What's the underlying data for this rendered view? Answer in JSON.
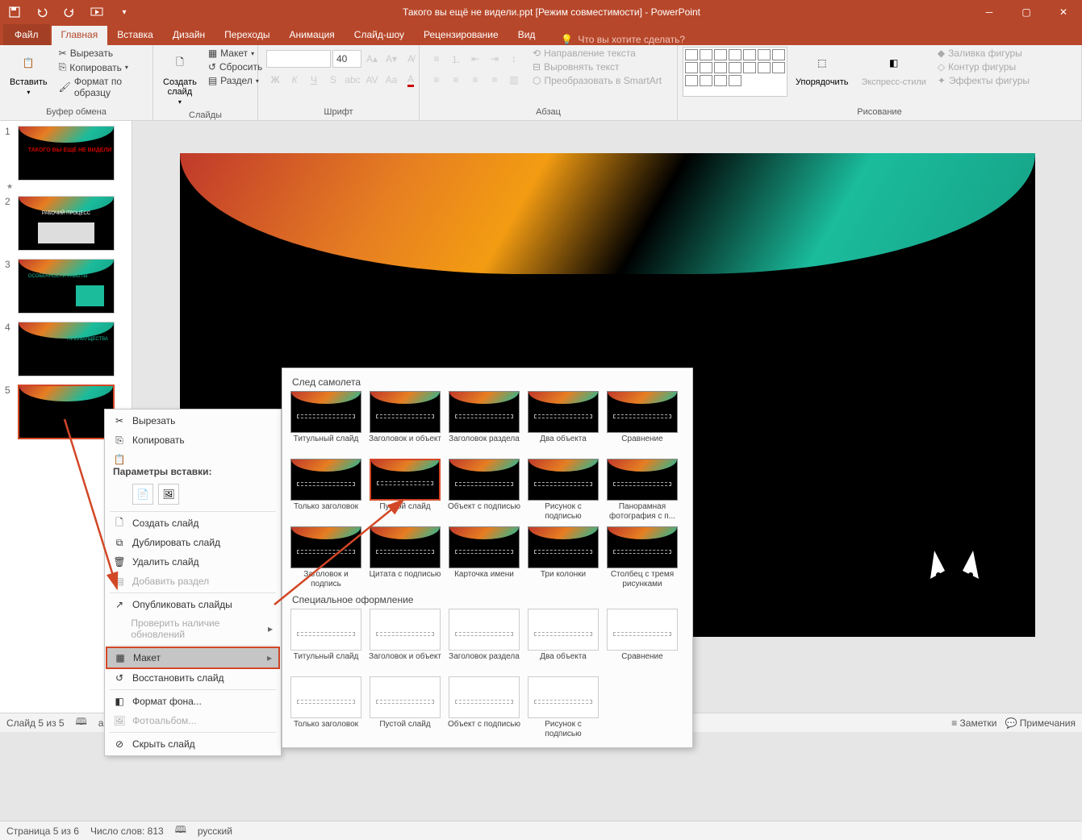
{
  "titlebar": {
    "title": "Такого вы ещё не видели.ppt [Режим совместимости] - PowerPoint"
  },
  "tabs": {
    "file": "Файл",
    "items": [
      "Главная",
      "Вставка",
      "Дизайн",
      "Переходы",
      "Анимация",
      "Слайд-шоу",
      "Рецензирование",
      "Вид"
    ],
    "active_index": 0,
    "tellme": "Что вы хотите сделать?"
  },
  "ribbon": {
    "clipboard": {
      "paste": "Вставить",
      "cut": "Вырезать",
      "copy": "Копировать",
      "format_painter": "Формат по образцу",
      "label": "Буфер обмена"
    },
    "slides": {
      "new_slide": "Создать слайд",
      "layout": "Макет",
      "reset": "Сбросить",
      "section": "Раздел",
      "label": "Слайды"
    },
    "font": {
      "size_value": "40",
      "label": "Шрифт"
    },
    "paragraph": {
      "text_direction": "Направление текста",
      "align_text": "Выровнять текст",
      "smartart": "Преобразовать в SmartArt",
      "label": "Абзац"
    },
    "drawing": {
      "arrange": "Упорядочить",
      "quick_styles": "Экспресс-стили",
      "shape_fill": "Заливка фигуры",
      "shape_outline": "Контур фигуры",
      "shape_effects": "Эффекты фигуры",
      "label": "Рисование"
    }
  },
  "slides": [
    {
      "num": "1",
      "title": "ТАКОГО ВЫ ЕЩЁ НЕ ВИДЕЛИ"
    },
    {
      "num": "2",
      "title": "РАБОЧИЙ ПРОЦЕСС"
    },
    {
      "num": "3",
      "title": "ОСОБЕННОСТИ РАБОТЫ"
    },
    {
      "num": "4",
      "title": "ПРЕИМУЩЕСТВА"
    },
    {
      "num": "5",
      "title": ""
    }
  ],
  "context_menu": {
    "cut": "Вырезать",
    "copy": "Копировать",
    "paste_options": "Параметры вставки:",
    "new_slide": "Создать слайд",
    "duplicate": "Дублировать слайд",
    "delete": "Удалить слайд",
    "add_section": "Добавить раздел",
    "publish": "Опубликовать слайды",
    "check_updates": "Проверить наличие обновлений",
    "layout": "Макет",
    "restore": "Восстановить слайд",
    "background": "Формат фона...",
    "photo_album": "Фотоальбом...",
    "hide": "Скрыть слайд"
  },
  "layout_gallery": {
    "section1": "След самолета",
    "section2": "Специальное оформление",
    "layouts1": [
      "Титульный слайд",
      "Заголовок и объект",
      "Заголовок раздела",
      "Два объекта",
      "Сравнение",
      "Только заголовок",
      "Пустой слайд",
      "Объект с подписью",
      "Рисунок с подписью",
      "Панорамная фотография с п...",
      "Заголовок и подпись",
      "Цитата с подписью",
      "Карточка имени",
      "Три колонки",
      "Столбец с тремя рисунками"
    ],
    "layouts2": [
      "Титульный слайд",
      "Заголовок и объект",
      "Заголовок раздела",
      "Два объекта",
      "Сравнение",
      "Только заголовок",
      "Пустой слайд",
      "Объект с подписью",
      "Рисунок с подписью"
    ],
    "selected_index": 6
  },
  "statusbar": {
    "slide_pos": "Слайд 5 из 5",
    "lang_short": "ан",
    "notes": "Заметки",
    "comments": "Примечания",
    "page_pos": "Страница 5 из 6",
    "word_count": "Число слов: 813",
    "lang": "русский"
  }
}
